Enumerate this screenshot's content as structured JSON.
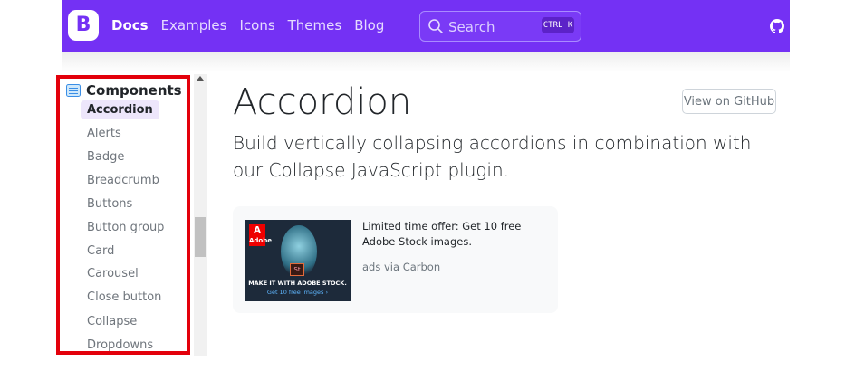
{
  "navbar": {
    "brand_letter": "B",
    "links": [
      "Docs",
      "Examples",
      "Icons",
      "Themes",
      "Blog"
    ],
    "search_placeholder": "Search",
    "search_shortcut": "CTRL K",
    "accent_color": "#7431f4"
  },
  "sidebar": {
    "section_title": "Components",
    "items": [
      "Accordion",
      "Alerts",
      "Badge",
      "Breadcrumb",
      "Buttons",
      "Button group",
      "Card",
      "Carousel",
      "Close button",
      "Collapse",
      "Dropdowns"
    ],
    "active_item": "Accordion",
    "highlight_color": "#e3000b"
  },
  "main": {
    "title": "Accordion",
    "github_button": "View on GitHub",
    "lead": "Build vertically collapsing accordions in combination with our Collapse JavaScript plugin."
  },
  "ad": {
    "logo_text": "Adobe",
    "product_badge": "St",
    "caption_main": "MAKE IT WITH ADOBE STOCK.",
    "caption_sub": "Get 10 free images ›",
    "text": "Limited time offer: Get 10 free Adobe Stock images.",
    "via": "ads via Carbon"
  }
}
